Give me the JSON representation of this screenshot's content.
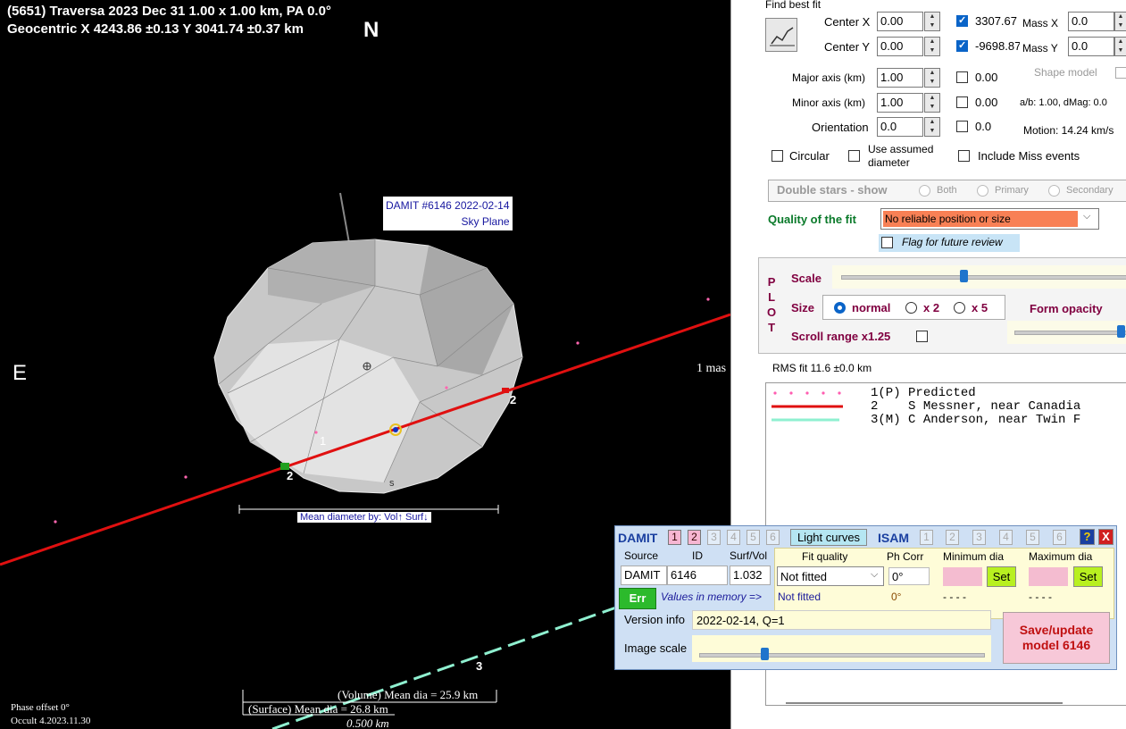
{
  "plot": {
    "title_line1": "(5651) Traversa  2023 Dec 31   1.00 x 1.00 km, PA 0.0°",
    "title_line2": "Geocentric  X  4243.86 ±0.13  Y 3041.74 ±0.37 km",
    "north": "N",
    "east": "E",
    "damit_tag1": "DAMIT #6146 2022-02-14",
    "damit_tag2": "Sky Plane",
    "one_mas": "1 mas",
    "mean_dia_label": "Mean diameter by:  Vol↑ Surf↓",
    "chord_labels": [
      "1",
      "2",
      "2",
      "3"
    ],
    "center_mark": "s",
    "volume_dia": "(Volume) Mean dia = 25.9 km",
    "surface_dia": "(Surface) Mean dia = 26.8 km",
    "scale_bar": "0.500 km",
    "phase_offset": "Phase offset 0°",
    "version": "Occult 4.2023.11.30"
  },
  "fit": {
    "heading": "Find best fit",
    "center_x_label": "Center X",
    "center_x": "0.00",
    "center_y_label": "Center Y",
    "center_y": "0.00",
    "center_x_val": "3307.67",
    "center_y_val": "-9698.87",
    "mass_x_label": "Mass X",
    "mass_x": "0.0",
    "mass_y_label": "Mass Y",
    "mass_y": "0.0",
    "major_label": "Major axis (km)",
    "major": "1.00",
    "major_val": "0.00",
    "minor_label": "Minor axis (km)",
    "minor": "1.00",
    "minor_val": "0.00",
    "orient_label": "Orientation",
    "orient": "0.0",
    "orient_val": "0.0",
    "shape_model": "Shape model",
    "ab_dmag": "a/b: 1.00, dMag: 0.0",
    "motion": "Motion: 14.24 km/s",
    "circular": "Circular",
    "use_assumed": "Use assumed diameter",
    "include_miss": "Include Miss events",
    "double_stars": "Double stars - show",
    "ds_both": "Both",
    "ds_primary": "Primary",
    "ds_secondary": "Secondary",
    "quality_label": "Quality of the fit",
    "quality_value": "No reliable position or size",
    "flag_review": "Flag for future review"
  },
  "plotpanel": {
    "side": [
      "P",
      "L",
      "O",
      "T"
    ],
    "scale": "Scale",
    "size": "Size",
    "normal": "normal",
    "x2": "x 2",
    "x5": "x 5",
    "form_opacity": "Form opacity",
    "scroll_range": "Scroll range x1.25"
  },
  "rms": "RMS fit 11.6 ±0.0 km",
  "legend": [
    {
      "num": "1(P)",
      "name": "Predicted"
    },
    {
      "num": "2   ",
      "name": "S Messner, near Canadia"
    },
    {
      "num": "3(M)",
      "name": "C Anderson, near Twin F"
    }
  ],
  "damit": {
    "title": "DAMIT",
    "nums": [
      "1",
      "2",
      "3",
      "4",
      "5",
      "6"
    ],
    "light_curves": "Light curves",
    "isam": "ISAM",
    "isam_nums": [
      "1",
      "2",
      "3",
      "4",
      "5",
      "6"
    ],
    "help": "?",
    "close": "X",
    "source_label": "Source",
    "id_label": "ID",
    "surfvol_label": "Surf/Vol",
    "fit_quality_label": "Fit quality",
    "phcorr_label": "Ph Corr",
    "min_dia_label": "Minimum dia",
    "max_dia_label": "Maximum dia",
    "source": "DAMIT",
    "id": "6146",
    "surfvol": "1.032",
    "fit_quality": "Not fitted",
    "phcorr": "0°",
    "set": "Set",
    "err": "Err",
    "values_mem": "Values in memory =>",
    "mem_fit": "Not fitted",
    "mem_ph": "0°",
    "mem_min": "- - - -",
    "mem_max": "- - - -",
    "version_label": "Version info",
    "version_value": "2022-02-14, Q=1",
    "image_scale": "Image scale",
    "save": "Save/update model 6146"
  },
  "colors": {
    "red_chord": "#e01010",
    "cyan_chord": "#8ff0d0",
    "orange_field": "#f88055",
    "damit_bg": "#cfe0f4"
  }
}
